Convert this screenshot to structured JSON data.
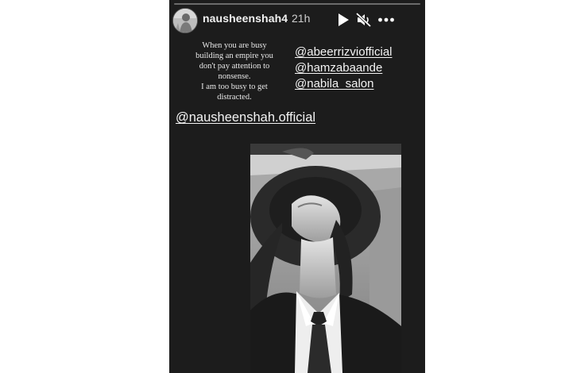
{
  "story": {
    "progress_fraction": 0.0,
    "header": {
      "username": "nausheenshah4",
      "timestamp": "21h",
      "controls": [
        "play-icon",
        "mute-icon",
        "more-icon"
      ]
    },
    "caption": {
      "lines": [
        "When you are busy",
        "building an empire you",
        "don't pay attention to",
        "nonsense.",
        "I am too busy to get",
        "distracted."
      ]
    },
    "mentions": [
      "@abeerrizviofficial",
      "@hamzabaande",
      "@nabila_salon"
    ],
    "main_mention": "@nausheenshah.official",
    "photo": {
      "description_icon": "portrait-photo"
    }
  },
  "colors": {
    "story_background": "#1c1c1c",
    "page_background": "#ffffff",
    "text": "#f4f4f4"
  }
}
